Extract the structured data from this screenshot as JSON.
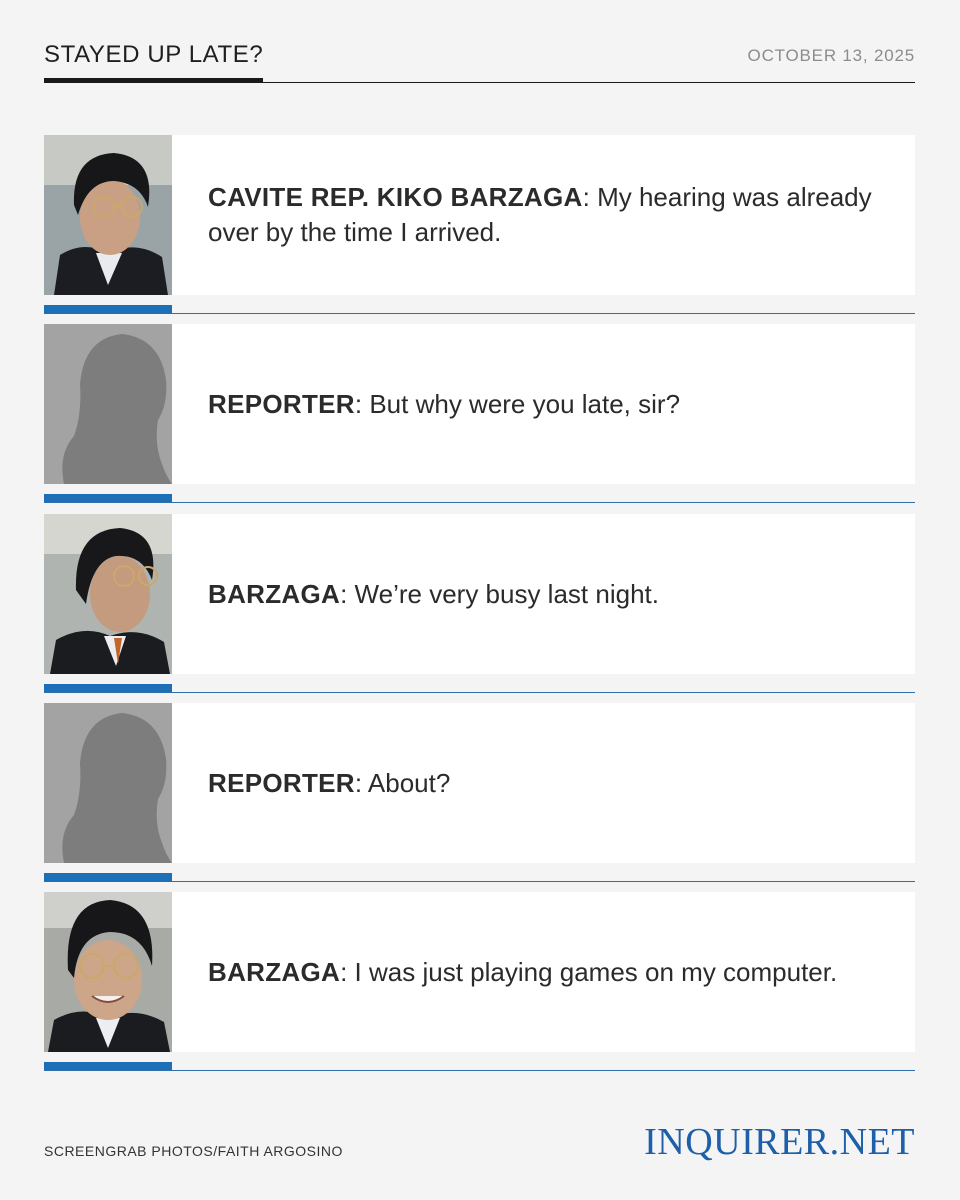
{
  "header": {
    "title": "STAYED UP LATE?",
    "date": "OCTOBER 13, 2025"
  },
  "dialogue": [
    {
      "speaker": "CAVITE REP. KIKO BARZAGA",
      "separator": ":",
      "line": " My hearing was already over by the time I arrived.",
      "photo": "barzaga-photo"
    },
    {
      "speaker": "REPORTER",
      "separator": ":",
      "line": " But why were you late, sir?",
      "photo": "reporter-silhouette"
    },
    {
      "speaker": "BARZAGA",
      "separator": ":",
      "line": " We’re very busy last night.",
      "photo": "barzaga-photo"
    },
    {
      "speaker": "REPORTER",
      "separator": ":",
      "line": " About?",
      "photo": "reporter-silhouette"
    },
    {
      "speaker": "BARZAGA",
      "separator": ":",
      "line": " I was just playing games on my computer.",
      "photo": "barzaga-photo"
    }
  ],
  "footer": {
    "credit": "SCREENGRAB PHOTOS/FAITH ARGOSINO",
    "logo": "INQUIRER.NET"
  },
  "colors": {
    "accent": "#1d6fb8",
    "background": "#f4f4f4",
    "logo": "#1d5fa8"
  }
}
